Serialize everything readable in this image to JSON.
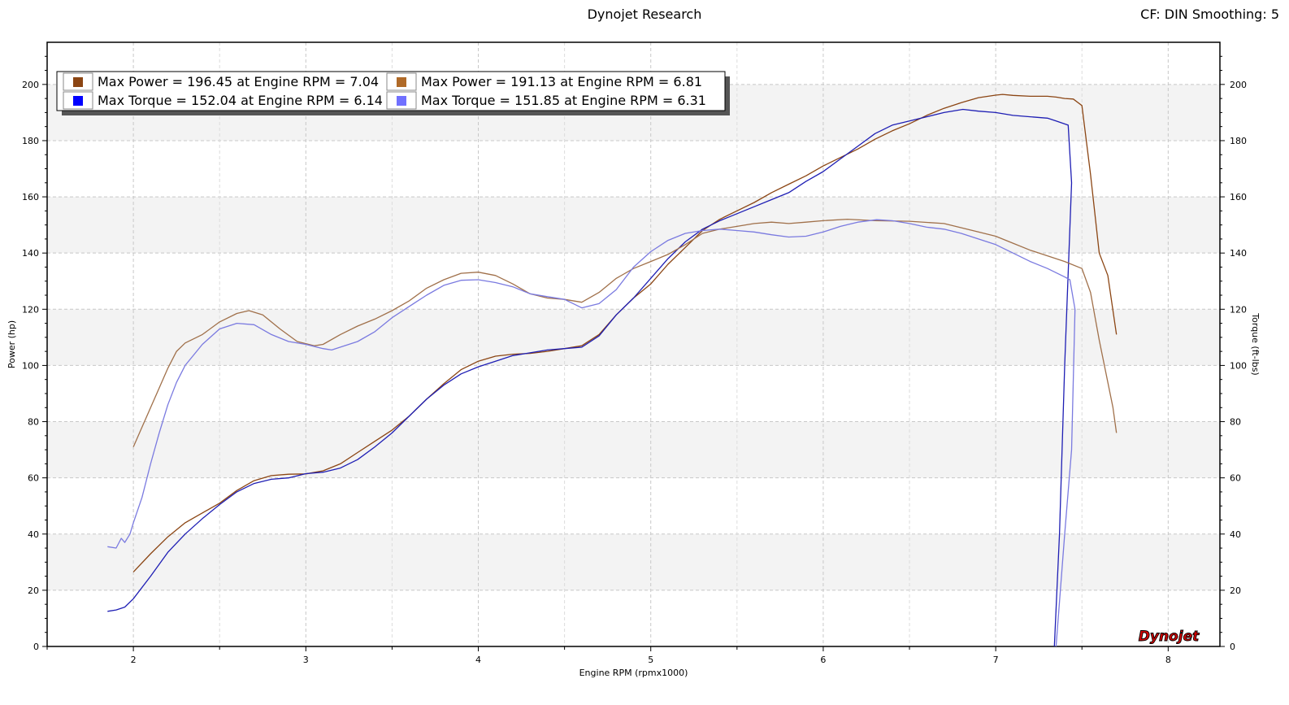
{
  "header": {
    "title": "Dynojet Research",
    "corner_text": "CF: DIN Smoothing: 5"
  },
  "logo_text": "Dynojet",
  "chart_data": {
    "type": "line",
    "xlabel": "Engine RPM (rpmx1000)",
    "ylabel_left": "Power (hp)",
    "ylabel_right": "Torque (ft-lbs)",
    "xlim": [
      1.5,
      8.3
    ],
    "ylim": [
      0,
      215
    ],
    "xticks": [
      2,
      3,
      4,
      5,
      6,
      7,
      8
    ],
    "yticks": [
      0,
      20,
      40,
      60,
      80,
      100,
      120,
      140,
      160,
      180,
      200
    ],
    "grid": true,
    "legend_position": "top-left",
    "legend": [
      "Max Power = 196.45 at Engine RPM = 7.04",
      "Max Torque = 152.04 at Engine RPM = 6.14",
      "Max Power = 191.13 at Engine RPM = 6.81",
      "Max Torque = 151.85 at Engine RPM = 6.31"
    ],
    "series": [
      {
        "kind": "power",
        "axis": "left",
        "color": "#8b4513",
        "legend_swatch": "#8b4513",
        "points": [
          [
            2.0,
            26.5
          ],
          [
            2.1,
            33
          ],
          [
            2.2,
            39
          ],
          [
            2.3,
            44
          ],
          [
            2.4,
            47.5
          ],
          [
            2.5,
            51
          ],
          [
            2.6,
            55.5
          ],
          [
            2.7,
            59
          ],
          [
            2.8,
            60.8
          ],
          [
            2.9,
            61.3
          ],
          [
            3.0,
            61.4
          ],
          [
            3.1,
            62.5
          ],
          [
            3.2,
            65
          ],
          [
            3.3,
            69
          ],
          [
            3.4,
            73
          ],
          [
            3.5,
            77
          ],
          [
            3.6,
            82
          ],
          [
            3.7,
            88
          ],
          [
            3.8,
            93.5
          ],
          [
            3.9,
            98.5
          ],
          [
            4.0,
            101.5
          ],
          [
            4.1,
            103.3
          ],
          [
            4.2,
            104
          ],
          [
            4.3,
            104.3
          ],
          [
            4.4,
            105
          ],
          [
            4.5,
            106
          ],
          [
            4.6,
            107
          ],
          [
            4.7,
            111
          ],
          [
            4.8,
            118
          ],
          [
            4.9,
            124
          ],
          [
            5.0,
            129
          ],
          [
            5.1,
            136
          ],
          [
            5.2,
            142
          ],
          [
            5.3,
            148
          ],
          [
            5.4,
            152
          ],
          [
            5.5,
            155
          ],
          [
            5.6,
            158
          ],
          [
            5.7,
            161.5
          ],
          [
            5.8,
            164.5
          ],
          [
            5.9,
            167.5
          ],
          [
            6.0,
            171
          ],
          [
            6.1,
            174
          ],
          [
            6.2,
            177
          ],
          [
            6.3,
            180.5
          ],
          [
            6.4,
            183.5
          ],
          [
            6.5,
            186
          ],
          [
            6.6,
            189
          ],
          [
            6.7,
            191.5
          ],
          [
            6.8,
            193.5
          ],
          [
            6.9,
            195.3
          ],
          [
            7.0,
            196.2
          ],
          [
            7.04,
            196.45
          ],
          [
            7.1,
            196.1
          ],
          [
            7.2,
            195.8
          ],
          [
            7.3,
            195.8
          ],
          [
            7.35,
            195.5
          ],
          [
            7.4,
            195
          ],
          [
            7.45,
            194.8
          ],
          [
            7.5,
            192.5
          ],
          [
            7.55,
            168
          ],
          [
            7.6,
            140
          ],
          [
            7.65,
            132
          ],
          [
            7.7,
            111
          ]
        ]
      },
      {
        "kind": "power",
        "axis": "left",
        "color": "#1e1eb4",
        "legend_swatch": "#0000ff",
        "points": [
          [
            1.85,
            12.5
          ],
          [
            1.9,
            13
          ],
          [
            1.95,
            14
          ],
          [
            2.0,
            17
          ],
          [
            2.1,
            25
          ],
          [
            2.2,
            33.5
          ],
          [
            2.3,
            40
          ],
          [
            2.4,
            45.5
          ],
          [
            2.5,
            50.5
          ],
          [
            2.6,
            55
          ],
          [
            2.7,
            58
          ],
          [
            2.8,
            59.5
          ],
          [
            2.9,
            60
          ],
          [
            3.0,
            61.5
          ],
          [
            3.1,
            62
          ],
          [
            3.2,
            63.5
          ],
          [
            3.3,
            66.5
          ],
          [
            3.4,
            71
          ],
          [
            3.5,
            76
          ],
          [
            3.6,
            82
          ],
          [
            3.7,
            88
          ],
          [
            3.8,
            93
          ],
          [
            3.9,
            97
          ],
          [
            4.0,
            99.5
          ],
          [
            4.1,
            101.5
          ],
          [
            4.2,
            103.5
          ],
          [
            4.3,
            104.5
          ],
          [
            4.4,
            105.5
          ],
          [
            4.5,
            106
          ],
          [
            4.6,
            106.5
          ],
          [
            4.7,
            110.5
          ],
          [
            4.8,
            118
          ],
          [
            4.9,
            124
          ],
          [
            5.0,
            131
          ],
          [
            5.1,
            138
          ],
          [
            5.2,
            144
          ],
          [
            5.3,
            148.5
          ],
          [
            5.4,
            151.5
          ],
          [
            5.5,
            154
          ],
          [
            5.6,
            156.5
          ],
          [
            5.7,
            159
          ],
          [
            5.8,
            161.5
          ],
          [
            5.9,
            165.5
          ],
          [
            6.0,
            169
          ],
          [
            6.1,
            173.5
          ],
          [
            6.2,
            178
          ],
          [
            6.3,
            182.5
          ],
          [
            6.4,
            185.5
          ],
          [
            6.5,
            187
          ],
          [
            6.6,
            188.5
          ],
          [
            6.7,
            190
          ],
          [
            6.81,
            191.13
          ],
          [
            6.9,
            190.5
          ],
          [
            7.0,
            190
          ],
          [
            7.1,
            189
          ],
          [
            7.2,
            188.5
          ],
          [
            7.3,
            188
          ],
          [
            7.35,
            187
          ],
          [
            7.42,
            185.5
          ],
          [
            7.44,
            165
          ],
          [
            7.4,
            100
          ],
          [
            7.37,
            40
          ],
          [
            7.34,
            0
          ]
        ]
      },
      {
        "kind": "torque",
        "axis": "right",
        "color": "#a0704a",
        "legend_swatch": "#b06a28",
        "points": [
          [
            2.0,
            71
          ],
          [
            2.05,
            78
          ],
          [
            2.1,
            85
          ],
          [
            2.15,
            92
          ],
          [
            2.2,
            99
          ],
          [
            2.25,
            105
          ],
          [
            2.3,
            108
          ],
          [
            2.4,
            111
          ],
          [
            2.5,
            115.5
          ],
          [
            2.6,
            118.5
          ],
          [
            2.67,
            119.5
          ],
          [
            2.75,
            118
          ],
          [
            2.85,
            113
          ],
          [
            2.95,
            108.5
          ],
          [
            3.05,
            107
          ],
          [
            3.1,
            107.5
          ],
          [
            3.2,
            111
          ],
          [
            3.3,
            114
          ],
          [
            3.4,
            116.5
          ],
          [
            3.5,
            119.5
          ],
          [
            3.6,
            123
          ],
          [
            3.7,
            127.5
          ],
          [
            3.8,
            130.5
          ],
          [
            3.9,
            132.8
          ],
          [
            4.0,
            133.2
          ],
          [
            4.1,
            132
          ],
          [
            4.2,
            129
          ],
          [
            4.3,
            125.5
          ],
          [
            4.4,
            124
          ],
          [
            4.5,
            123.5
          ],
          [
            4.6,
            122.5
          ],
          [
            4.7,
            126
          ],
          [
            4.8,
            131
          ],
          [
            4.9,
            134.5
          ],
          [
            5.0,
            137
          ],
          [
            5.1,
            139.5
          ],
          [
            5.2,
            143
          ],
          [
            5.3,
            147
          ],
          [
            5.4,
            148.5
          ],
          [
            5.5,
            149.5
          ],
          [
            5.6,
            150.5
          ],
          [
            5.7,
            151
          ],
          [
            5.8,
            150.5
          ],
          [
            5.9,
            151
          ],
          [
            6.0,
            151.5
          ],
          [
            6.14,
            152.04
          ],
          [
            6.3,
            151.5
          ],
          [
            6.5,
            151.3
          ],
          [
            6.7,
            150.5
          ],
          [
            6.9,
            147.5
          ],
          [
            7.0,
            146
          ],
          [
            7.1,
            143.5
          ],
          [
            7.2,
            141
          ],
          [
            7.3,
            139
          ],
          [
            7.4,
            137
          ],
          [
            7.5,
            134.5
          ],
          [
            7.55,
            126
          ],
          [
            7.6,
            109
          ],
          [
            7.65,
            94
          ],
          [
            7.68,
            85
          ],
          [
            7.7,
            76
          ]
        ]
      },
      {
        "kind": "torque",
        "axis": "right",
        "color": "#7a7ae0",
        "legend_swatch": "#7070ff",
        "points": [
          [
            1.85,
            35.5
          ],
          [
            1.9,
            35
          ],
          [
            1.93,
            38.5
          ],
          [
            1.95,
            37
          ],
          [
            1.98,
            40
          ],
          [
            2.0,
            44
          ],
          [
            2.05,
            53
          ],
          [
            2.1,
            65
          ],
          [
            2.15,
            76
          ],
          [
            2.2,
            86
          ],
          [
            2.25,
            94
          ],
          [
            2.3,
            100
          ],
          [
            2.4,
            107.5
          ],
          [
            2.5,
            113
          ],
          [
            2.6,
            115
          ],
          [
            2.7,
            114.5
          ],
          [
            2.8,
            111
          ],
          [
            2.9,
            108.5
          ],
          [
            3.0,
            107.5
          ],
          [
            3.1,
            106
          ],
          [
            3.15,
            105.5
          ],
          [
            3.3,
            108.5
          ],
          [
            3.4,
            112
          ],
          [
            3.5,
            117
          ],
          [
            3.6,
            121
          ],
          [
            3.7,
            125
          ],
          [
            3.8,
            128.5
          ],
          [
            3.9,
            130.3
          ],
          [
            4.0,
            130.5
          ],
          [
            4.1,
            129.5
          ],
          [
            4.2,
            128
          ],
          [
            4.3,
            125.5
          ],
          [
            4.4,
            124.5
          ],
          [
            4.5,
            123.5
          ],
          [
            4.6,
            120.5
          ],
          [
            4.7,
            122
          ],
          [
            4.8,
            127
          ],
          [
            4.9,
            135
          ],
          [
            5.0,
            140.5
          ],
          [
            5.1,
            144.5
          ],
          [
            5.2,
            147
          ],
          [
            5.3,
            148
          ],
          [
            5.4,
            148.5
          ],
          [
            5.5,
            148
          ],
          [
            5.6,
            147.5
          ],
          [
            5.7,
            146.5
          ],
          [
            5.8,
            145.7
          ],
          [
            5.9,
            146
          ],
          [
            6.0,
            147.5
          ],
          [
            6.1,
            149.5
          ],
          [
            6.2,
            151
          ],
          [
            6.31,
            151.85
          ],
          [
            6.4,
            151.5
          ],
          [
            6.5,
            150.5
          ],
          [
            6.6,
            149.2
          ],
          [
            6.7,
            148.5
          ],
          [
            6.8,
            147
          ],
          [
            6.9,
            145
          ],
          [
            7.0,
            143
          ],
          [
            7.1,
            140
          ],
          [
            7.2,
            137
          ],
          [
            7.3,
            134.5
          ],
          [
            7.4,
            131.5
          ],
          [
            7.43,
            130.5
          ],
          [
            7.46,
            120
          ],
          [
            7.44,
            70
          ],
          [
            7.4,
            40
          ],
          [
            7.35,
            0
          ]
        ]
      }
    ]
  }
}
